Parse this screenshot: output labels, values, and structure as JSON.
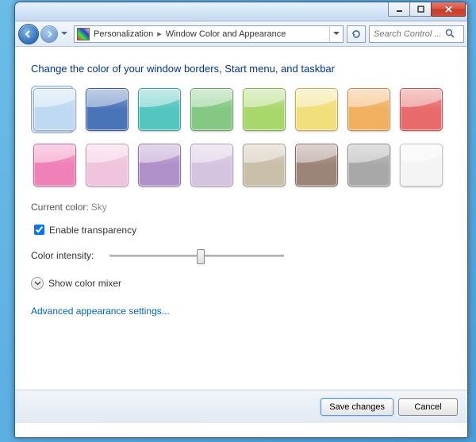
{
  "window": {
    "breadcrumb": {
      "segment1": "Personalization",
      "segment2": "Window Color and Appearance"
    },
    "search_placeholder": "Search Control ..."
  },
  "page": {
    "heading": "Change the color of your window borders, Start menu, and taskbar",
    "current_color_label": "Current color:",
    "current_color_value": "Sky",
    "enable_transparency_label": "Enable transparency",
    "enable_transparency_checked": true,
    "color_intensity_label": "Color intensity:",
    "color_intensity_value": 50,
    "show_color_mixer_label": "Show color mixer",
    "advanced_link": "Advanced appearance settings..."
  },
  "swatches": [
    {
      "name": "Sky",
      "color": "#bfd9f2",
      "selected": true
    },
    {
      "name": "Twilight",
      "color": "#4a74b8",
      "selected": false
    },
    {
      "name": "Sea",
      "color": "#55c5c0",
      "selected": false
    },
    {
      "name": "Leaf",
      "color": "#84c884",
      "selected": false
    },
    {
      "name": "Lime",
      "color": "#a8d86c",
      "selected": false
    },
    {
      "name": "Sun",
      "color": "#f0df7a",
      "selected": false
    },
    {
      "name": "Pumpkin",
      "color": "#f0b060",
      "selected": false
    },
    {
      "name": "Ruby",
      "color": "#e86a6a",
      "selected": false
    },
    {
      "name": "Fuchsia",
      "color": "#f080b8",
      "selected": false
    },
    {
      "name": "Blush",
      "color": "#f0c4dc",
      "selected": false
    },
    {
      "name": "Violet",
      "color": "#b090c8",
      "selected": false
    },
    {
      "name": "Lavender",
      "color": "#d4c4e0",
      "selected": false
    },
    {
      "name": "Taupe",
      "color": "#cabfa8",
      "selected": false
    },
    {
      "name": "Chocolate",
      "color": "#9c8478",
      "selected": false
    },
    {
      "name": "Slate",
      "color": "#a8a8a8",
      "selected": false
    },
    {
      "name": "Frost",
      "color": "#f4f4f4",
      "selected": false
    }
  ],
  "footer": {
    "save_label": "Save changes",
    "cancel_label": "Cancel"
  }
}
